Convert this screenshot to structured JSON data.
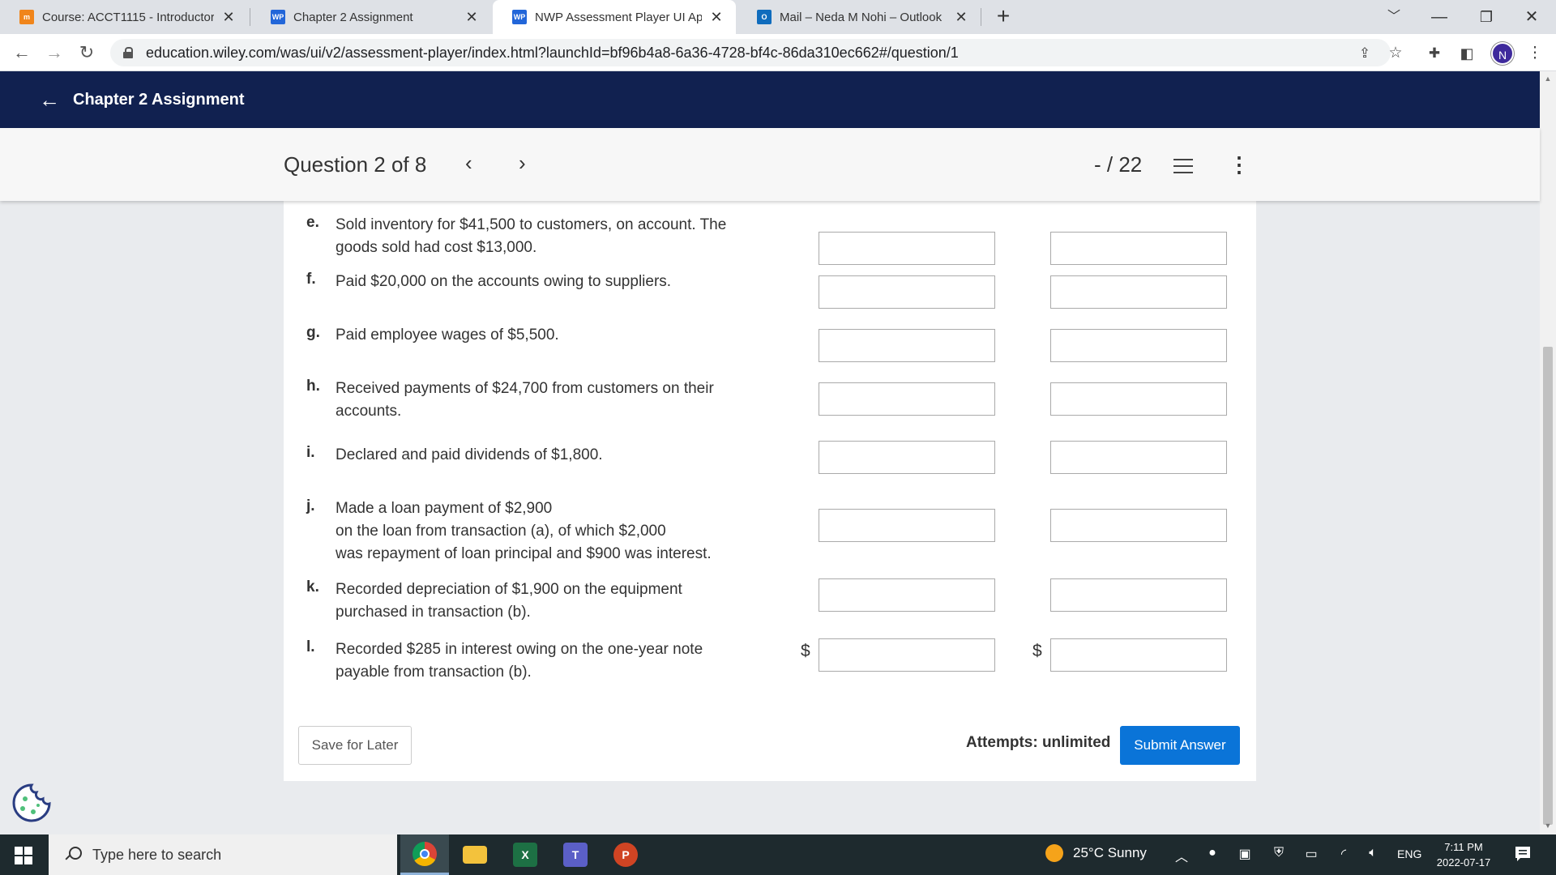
{
  "browser": {
    "tabs": [
      {
        "title": "Course: ACCT1115 - Introductory",
        "favicon": "moodle-icon"
      },
      {
        "title": "Chapter 2 Assignment",
        "favicon": "wp-icon"
      },
      {
        "title": "NWP Assessment Player UI Appli",
        "favicon": "wp-icon"
      },
      {
        "title": "Mail – Neda M Nohi – Outlook",
        "favicon": "outlook-icon"
      }
    ],
    "close_glyph": "✕",
    "new_tab_glyph": "+",
    "url": "education.wiley.com/was/ui/v2/assessment-player/index.html?launchId=bf96b4a8-6a36-4728-bf4c-86da310ec662#/question/1",
    "profile_initial": "N"
  },
  "header": {
    "title": "Chapter 2 Assignment"
  },
  "question_bar": {
    "label": "Question 2 of 8",
    "score": "- / 22"
  },
  "transactions": [
    {
      "letter": "e.",
      "text": "Sold inventory for $41,500 to customers, on account. The goods sold had cost $13,000.",
      "dollar": false
    },
    {
      "letter": "f.",
      "text": "Paid $20,000 on the accounts owing to suppliers.",
      "dollar": false
    },
    {
      "letter": "g.",
      "text": "Paid employee wages of $5,500.",
      "dollar": false
    },
    {
      "letter": "h.",
      "text": "Received payments of $24,700 from customers on their accounts.",
      "dollar": false
    },
    {
      "letter": "i.",
      "text": "Declared and paid dividends of $1,800.",
      "dollar": false
    },
    {
      "letter": "j.",
      "text": "Made a loan payment of $2,900\non the loan from transaction (a), of which $2,000\nwas repayment of loan principal and $900 was interest.",
      "dollar": false
    },
    {
      "letter": "k.",
      "text": "Recorded depreciation of $1,900 on the equipment purchased in transaction (b).",
      "dollar": false
    },
    {
      "letter": "l.",
      "text": "Recorded $285 in interest owing on the one-year note payable from transaction (b).",
      "dollar": true
    }
  ],
  "dollar_sign": "$",
  "actions": {
    "save_label": "Save for Later",
    "attempts_label": "Attempts: unlimited",
    "submit_label": "Submit Answer"
  },
  "taskbar": {
    "search_placeholder": "Type here to search",
    "weather": "25°C  Sunny",
    "language": "ENG",
    "time": "7:11 PM",
    "date": "2022-07-17"
  },
  "colors": {
    "header_bg": "#112150",
    "submit_bg": "#0a74d8",
    "profile_bg": "#3f2a9c"
  }
}
